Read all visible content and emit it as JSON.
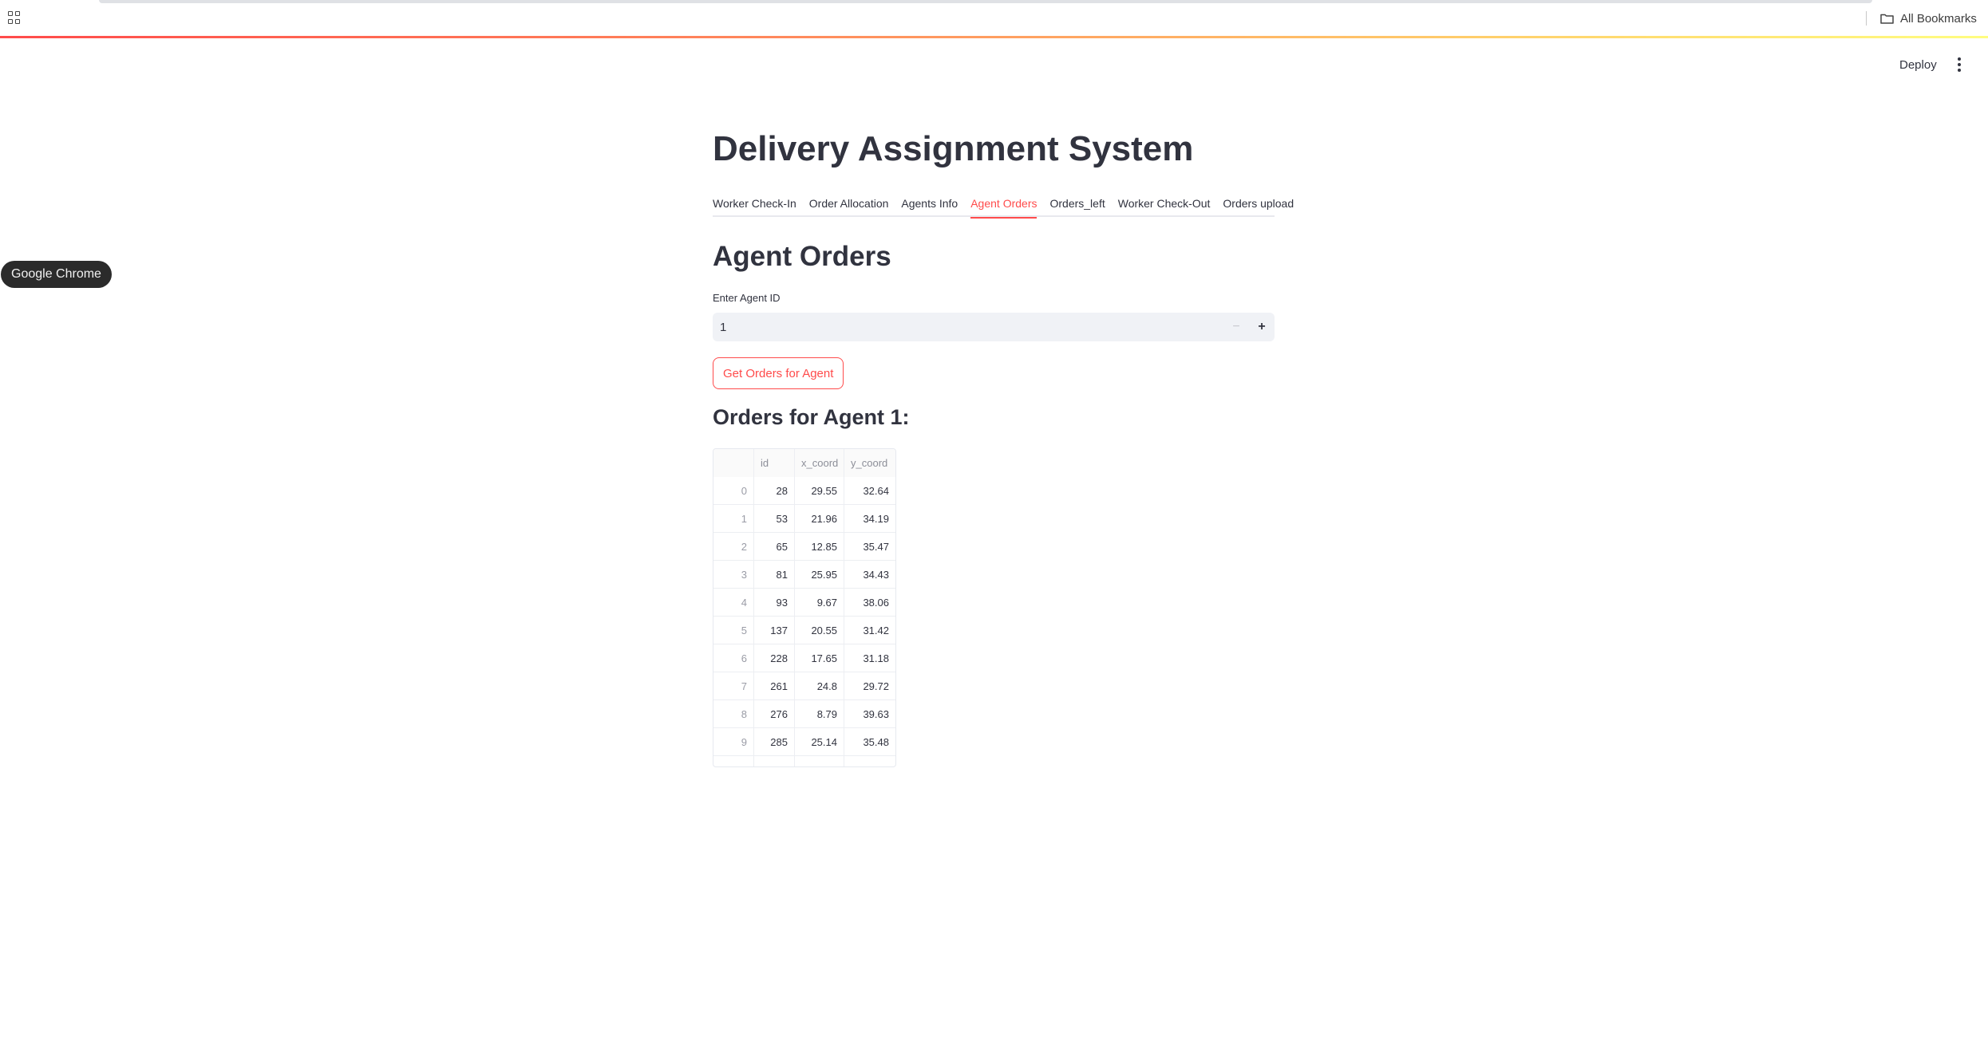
{
  "browser": {
    "bookmarks_label": "All Bookmarks",
    "tooltip": "Google Chrome"
  },
  "header": {
    "deploy_label": "Deploy"
  },
  "colors": {
    "accent": "#ff4b4b",
    "text": "#31333f",
    "input_bg": "#f0f2f6"
  },
  "page": {
    "title": "Delivery Assignment System"
  },
  "tabs": [
    {
      "label": "Worker Check-In"
    },
    {
      "label": "Order Allocation"
    },
    {
      "label": "Agents Info"
    },
    {
      "label": "Agent Orders",
      "active": true
    },
    {
      "label": "Orders_left"
    },
    {
      "label": "Worker Check-Out"
    },
    {
      "label": "Orders upload"
    }
  ],
  "agent_orders": {
    "heading": "Agent Orders",
    "input_label": "Enter Agent ID",
    "input_value": "1",
    "minus_label": "−",
    "plus_label": "+",
    "button_label": "Get Orders for Agent",
    "result_heading": "Orders for Agent 1:"
  },
  "table": {
    "columns": [
      "",
      "id",
      "x_coord",
      "y_coord"
    ],
    "rows": [
      [
        "0",
        "28",
        "29.55",
        "32.64"
      ],
      [
        "1",
        "53",
        "21.96",
        "34.19"
      ],
      [
        "2",
        "65",
        "12.85",
        "35.47"
      ],
      [
        "3",
        "81",
        "25.95",
        "34.43"
      ],
      [
        "4",
        "93",
        "9.67",
        "38.06"
      ],
      [
        "5",
        "137",
        "20.55",
        "31.42"
      ],
      [
        "6",
        "228",
        "17.65",
        "31.18"
      ],
      [
        "7",
        "261",
        "24.8",
        "29.72"
      ],
      [
        "8",
        "276",
        "8.79",
        "39.63"
      ],
      [
        "9",
        "285",
        "25.14",
        "35.48"
      ]
    ]
  }
}
